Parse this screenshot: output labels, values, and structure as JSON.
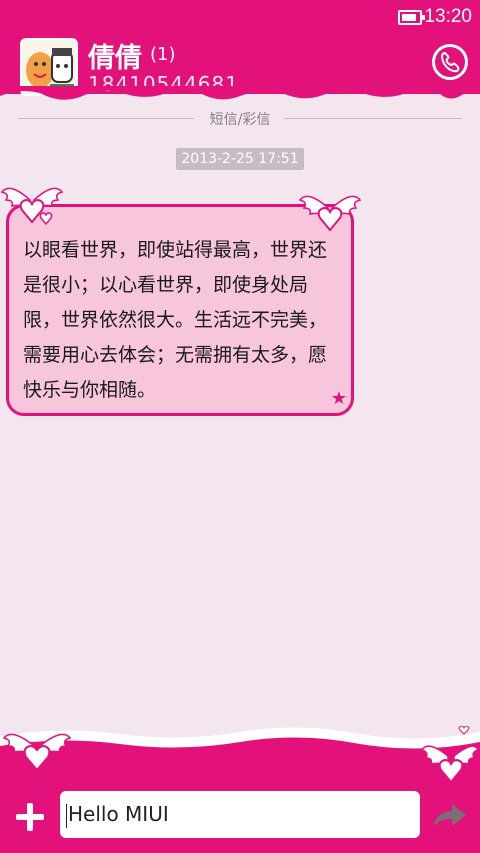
{
  "status_bar": {
    "time": "13:20",
    "battery_level": 0.85
  },
  "header": {
    "contact_name": "倩倩",
    "unread_count": "(1)",
    "phone_number": "18410544681"
  },
  "conversation": {
    "channel_label": "短信/彩信",
    "timestamp": "2013-2-25 17:51",
    "messages": [
      {
        "text": "以眼看世界，即使站得最高，世界还是很小；以心看世界，即使身处局限，世界依然很大。生活远不完美，需要用心去体会；无需拥有太多，愿快乐与你相随。"
      }
    ]
  },
  "composer": {
    "input_value": "Hello MIUI"
  },
  "colors": {
    "accent": "#e2127a",
    "bubble": "#f8c6dc",
    "background": "#f4e6ee"
  }
}
